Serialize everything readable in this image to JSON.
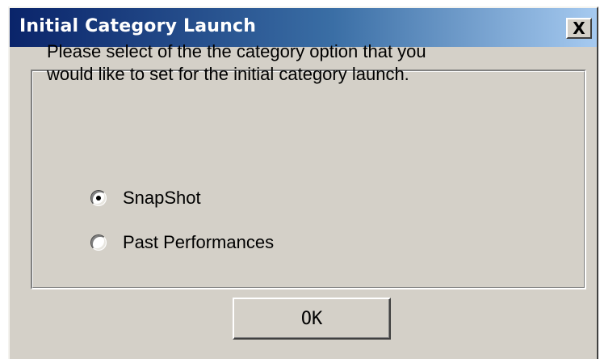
{
  "window": {
    "title": "Initial Category Launch",
    "close_label": "X"
  },
  "prompt": {
    "line1": "Please select of the the category option that you",
    "line2": "would like to set for the initial category launch."
  },
  "options": [
    {
      "label": "SnapShot",
      "selected": true
    },
    {
      "label": "Past Performances",
      "selected": false
    }
  ],
  "buttons": {
    "ok_label": "OK"
  }
}
